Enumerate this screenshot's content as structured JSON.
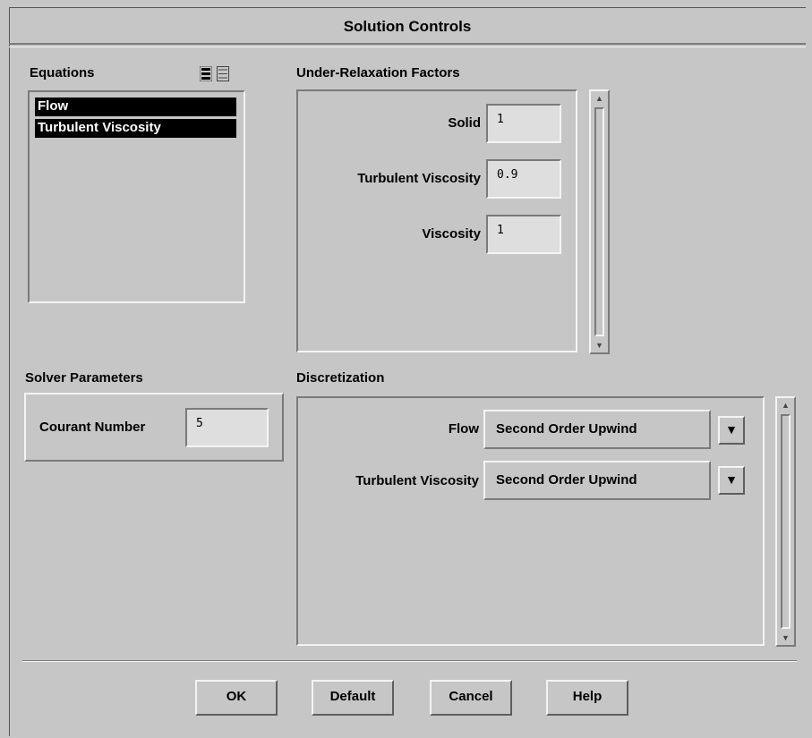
{
  "window": {
    "title": "Solution Controls"
  },
  "equations": {
    "label": "Equations",
    "icons": [
      "select-all-icon",
      "deselect-all-icon"
    ],
    "items": [
      "Flow",
      "Turbulent Viscosity"
    ]
  },
  "under_relaxation": {
    "label": "Under-Relaxation Factors",
    "fields": [
      {
        "label": "Solid",
        "value": "1"
      },
      {
        "label": "Turbulent Viscosity",
        "value": "0.9"
      },
      {
        "label": "Viscosity",
        "value": "1"
      }
    ]
  },
  "solver": {
    "label": "Solver Parameters",
    "courant_label": "Courant Number",
    "courant_value": "5"
  },
  "discretization": {
    "label": "Discretization",
    "rows": [
      {
        "label": "Flow",
        "value": "Second Order Upwind"
      },
      {
        "label": "Turbulent Viscosity",
        "value": "Second Order Upwind"
      }
    ]
  },
  "buttons": {
    "ok": "OK",
    "default": "Default",
    "cancel": "Cancel",
    "help": "Help"
  },
  "colors": {
    "background": "#c6c6c6",
    "field": "#dedede",
    "selection": "#000000"
  }
}
